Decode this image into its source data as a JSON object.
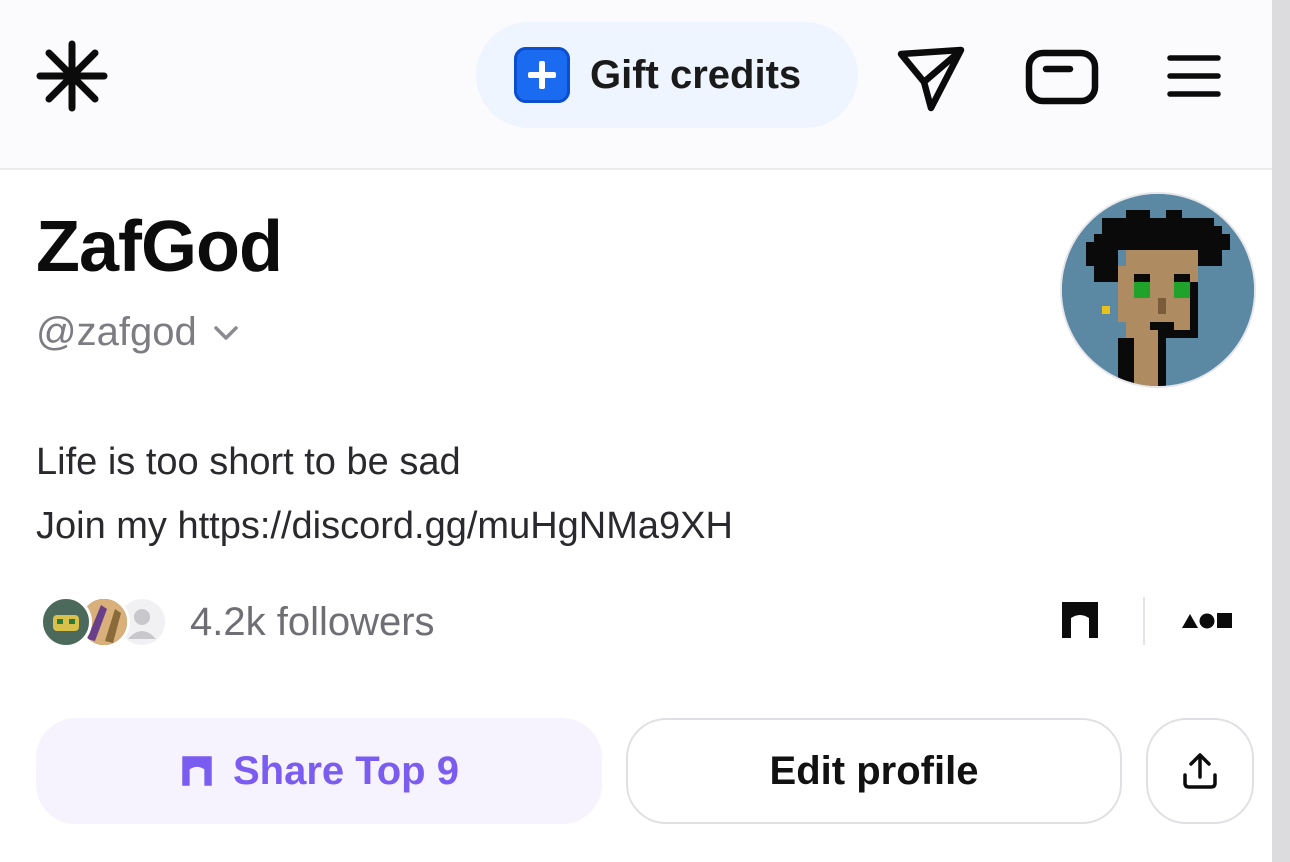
{
  "header": {
    "logo_icon": "asterisk-logo-icon",
    "gift_button": {
      "icon": "plus-icon",
      "label": "Gift credits"
    },
    "icons": [
      "send-icon",
      "card-icon",
      "menu-icon"
    ],
    "accent_color": "#1b6bf0"
  },
  "profile": {
    "display_name": "ZafGod",
    "handle": "@zafgod",
    "bio_lines": [
      "Life is too short to be sad",
      "Join my https://discord.gg/muHgNMa9XH"
    ],
    "followers_label": "4.2k followers",
    "avatar_icon": "pixel-punk-avatar"
  },
  "links": {
    "icons": [
      "arch-icon",
      "shapes-icon"
    ]
  },
  "actions": {
    "share_label": "Share Top 9",
    "share_color": "#7b5cf0",
    "edit_label": "Edit profile",
    "upload_icon": "upload-icon"
  }
}
